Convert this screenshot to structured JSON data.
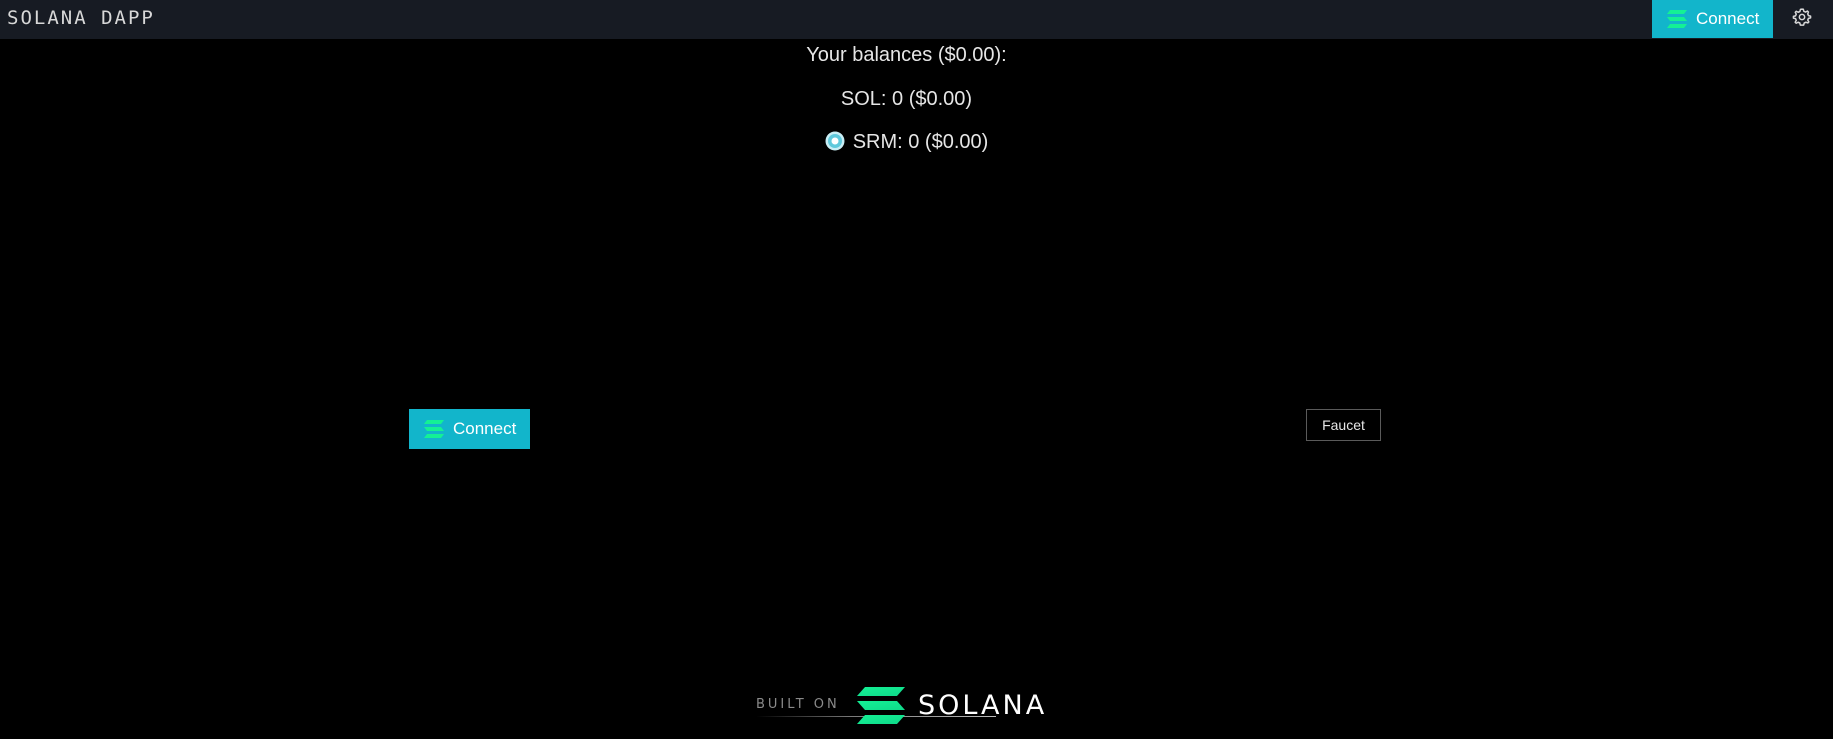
{
  "header": {
    "brand": "SOLANA DAPP",
    "connect_label": "Connect",
    "settings_icon": "gear-icon"
  },
  "balances": {
    "title": "Your balances ($0.00):",
    "sol": "SOL: 0 ($0.00)",
    "srm": "SRM: 0 ($0.00)"
  },
  "actions": {
    "connect_label": "Connect",
    "faucet_label": "Faucet"
  },
  "footer": {
    "built_on": "BUILT ON",
    "solana": "SOLANA"
  },
  "colors": {
    "accent": "#12b5cb",
    "solana_green": "#14f195",
    "header_bg": "#171b23",
    "page_bg": "#000000"
  }
}
